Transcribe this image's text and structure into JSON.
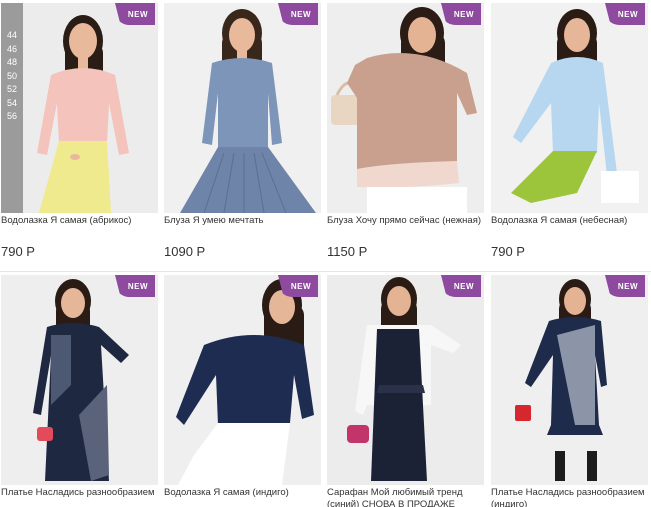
{
  "sizes": [
    "44",
    "46",
    "48",
    "50",
    "52",
    "54",
    "56"
  ],
  "badge_label": "NEW",
  "colors": {
    "badge": "#8d4a9e",
    "sizes_panel": "#9b9b9b"
  },
  "products": [
    {
      "title": "Водолазка Я самая (абрикос)",
      "price": "790 Р"
    },
    {
      "title": "Блуза Я умею мечтать",
      "price": "1090 Р"
    },
    {
      "title": "Блуза Хочу прямо сейчас (нежная)",
      "price": "1150 Р"
    },
    {
      "title": "Водолазка Я самая (небесная)",
      "price": "790 Р"
    },
    {
      "title": "Платье Насладись разнообразием",
      "price": ""
    },
    {
      "title": "Водолазка Я самая (индиго)",
      "price": ""
    },
    {
      "title": "Сарафан Мой любимый тренд (синий) СНОВА В ПРОДАЖЕ",
      "price": ""
    },
    {
      "title": "Платье Насладись разнообразием (индиго)",
      "price": ""
    }
  ]
}
